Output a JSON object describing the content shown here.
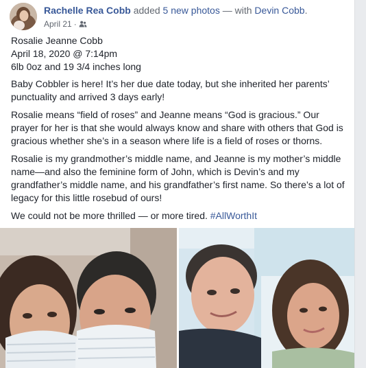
{
  "post": {
    "author": "Rachelle Rea Cobb",
    "action_text": "added",
    "photos_link": "5 new photos",
    "with_text": "— with",
    "tagged": "Devin Cobb",
    "end_punct": ".",
    "date": "April 21",
    "separator": "·",
    "audience_icon": "friends-icon"
  },
  "content": {
    "line1": "Rosalie Jeanne Cobb",
    "line2": "April 18, 2020 @ 7:14pm",
    "line3": "6lb 0oz and 19 3/4 inches long",
    "para2": "Baby Cobbler is here! It’s her due date today, but she inherited her parents’ punctuality and arrived 3 days early!",
    "para3": "Rosalie means “field of roses” and Jeanne means “God is gracious.” Our prayer for her is that she would always know and share with others that God is gracious whether she’s in a season where life is a field of roses or thorns.",
    "para4": "Rosalie is my grandmother’s middle name, and Jeanne is my mother’s middle name—and also the feminine form of John, which is Devin’s and my grandfather’s middle name, and his grandfather’s first name. So there’s a lot of legacy for this little rosebud of ours!",
    "para5_text": "We could not be more thrilled — or more tired.",
    "hashtag": "#AllWorthIt"
  },
  "colors": {
    "link": "#385898",
    "text": "#1d2129",
    "meta": "#616770",
    "background": "#e9ebee"
  }
}
